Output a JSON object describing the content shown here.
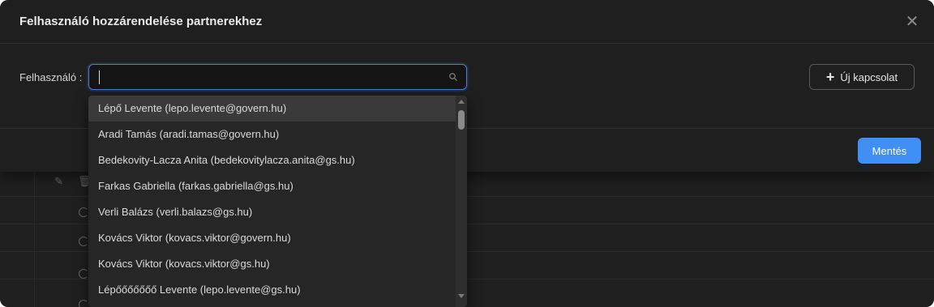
{
  "modal": {
    "title": "Felhasználó hozzárendelése partnerekhez",
    "close_icon": "close-icon",
    "field_label": "Felhasználó :",
    "search_value": "",
    "search_icon": "search-icon",
    "new_button_label": "Új kapcsolat",
    "new_button_icon": "plus-icon",
    "save_button_label": "Mentés"
  },
  "dropdown": {
    "options": [
      "Lépő Levente (lepo.levente@govern.hu)",
      "Aradi Tamás (aradi.tamas@govern.hu)",
      "Bedekovity-Lacza Anita (bedekovitylacza.anita@gs.hu)",
      "Farkas Gabriella (farkas.gabriella@gs.hu)",
      "Verli Balázs (verli.balazs@gs.hu)",
      "Kovács Viktor (kovacs.viktor@govern.hu)",
      "Kovács Viktor (kovacs.viktor@gs.hu)",
      "Lépőőőőőőő Levente (lepo.levente@gs.hu)"
    ],
    "active_index": 0
  },
  "colors": {
    "accent": "#3f8ff5",
    "background": "#1f1f1f",
    "focus_border": "#4a7fd6"
  }
}
